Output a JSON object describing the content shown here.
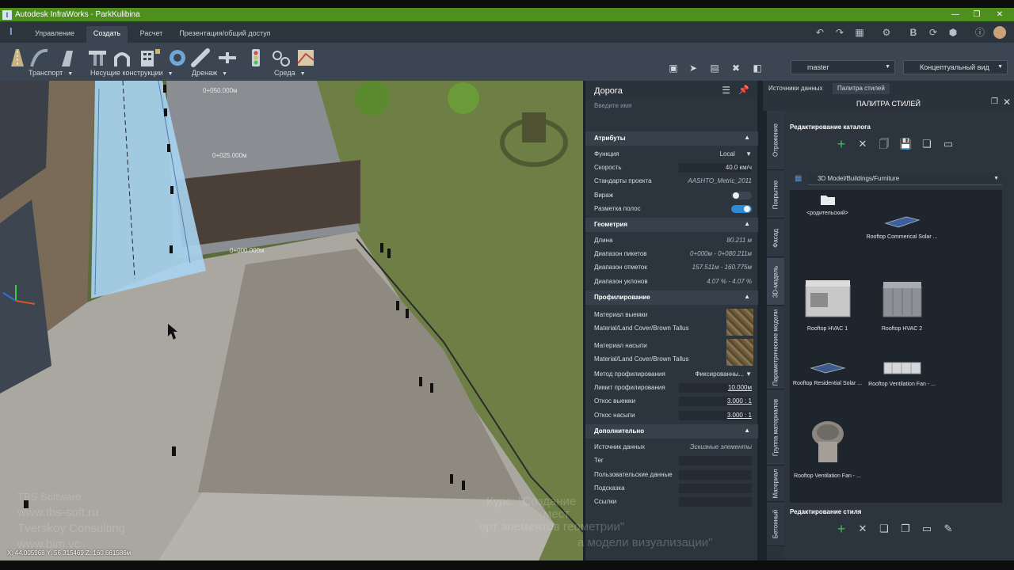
{
  "window": {
    "title": "Autodesk InfraWorks - ParkKulibina",
    "app_icon": "I"
  },
  "menu": {
    "tabs": [
      "Управление",
      "Создать",
      "Расчет",
      "Презентация/общий доступ"
    ],
    "active_tab": "Создать"
  },
  "ribbon": {
    "groups": [
      "Транспорт",
      "Несущие конструкции",
      "Дренаж",
      "Среда"
    ],
    "branch": "master",
    "view_mode": "Концептуальный вид"
  },
  "viewport": {
    "station_labels": [
      "0+050.000м",
      "0+025.000м",
      "0+000.000м"
    ],
    "coords": "X: 44.005968 Y: 56.315469 Z: 160.661586м"
  },
  "properties": {
    "title": "Дорога",
    "name_placeholder": "Введите имя",
    "attributes": {
      "header": "Атрибуты",
      "function_label": "Функция",
      "function_value": "Local",
      "speed_label": "Скорость",
      "speed_value": "40.0",
      "speed_unit": "км/ч",
      "standards_label": "Стандарты проекта",
      "standards_value": "AASHTO_Metric_2011",
      "superelevation_label": "Вираж",
      "lane_marking_label": "Разметка полос"
    },
    "geometry": {
      "header": "Геометрия",
      "length_label": "Длина",
      "length_value": "80.211  м",
      "station_range_label": "Диапазон пикетов",
      "station_range_value": "0+000м - 0+080.211м",
      "elev_range_label": "Диапазон отметок",
      "elev_range_value": "157.511м - 160.775м",
      "slope_range_label": "Диапазон уклонов",
      "slope_range_value": "4.07 % - 4.07 %"
    },
    "grading": {
      "header": "Профилирование",
      "cut_material_label": "Материал выемки",
      "cut_material_value": "Material/Land Cover/Brown Tallus",
      "fill_material_label": "Материал насыпи",
      "fill_material_value": "Material/Land Cover/Brown Tallus",
      "method_label": "Метод профилирования",
      "method_value": "Фиксированны...",
      "limit_label": "Лимит профилирования",
      "limit_value": "10.000м",
      "cut_slope_label": "Откос выемки",
      "cut_slope_value": "3.000 : 1",
      "fill_slope_label": "Откос насыпи",
      "fill_slope_value": "3.000 : 1"
    },
    "extra": {
      "header": "Дополнительно",
      "source_label": "Источник данных",
      "source_value": "Эскизные элементы",
      "tag_label": "Тег",
      "user_data_label": "Пользовательские данные",
      "hint_label": "Подсказка",
      "links_label": "Ссылки"
    }
  },
  "palette": {
    "tabs": [
      "Источники данных",
      "Палитра стилей"
    ],
    "active_tab": "Палитра стилей",
    "title": "ПАЛИТРА СТИЛЕЙ",
    "side_tabs": [
      "Отражение",
      "Покрытие",
      "Фасад",
      "3D-модель",
      "Параметрические модели",
      "Группа материалов",
      "Материал",
      "Бетонный"
    ],
    "active_side_tab": "3D-модель",
    "catalog_edit_label": "Редактирование каталога",
    "style_edit_label": "Редактирование стиля",
    "catalog_path": "3D Model/Buildings/Furniture",
    "items": [
      {
        "label": "<родительский>",
        "icon": "folder-icon"
      },
      {
        "label": "Rooftop Commerical Solar ...",
        "icon": "solar-panel-icon"
      },
      {
        "label": "Rooftop HVAC 1",
        "icon": "hvac-icon"
      },
      {
        "label": "Rooftop HVAC 2",
        "icon": "hvac-icon"
      },
      {
        "label": "Rooftop Residential Solar ...",
        "icon": "solar-panel-icon"
      },
      {
        "label": "Rooftop Ventilation Fan - ...",
        "icon": "fan-icon"
      },
      {
        "label": "Rooftop Ventilation Fan - ...",
        "icon": "turbine-vent-icon"
      }
    ]
  },
  "watermark": {
    "left_lines": [
      "TBS Software",
      "www.tbs-soft.ru",
      "Tverskoy Consulting",
      "www.bim.vc"
    ],
    "right_lines": [
      "Курс: \"Создание",
      "мест",
      "орт элементов геометрии\"",
      "а модели визуализации\""
    ]
  },
  "colors": {
    "accent": "#2f8ad6",
    "titlebar": "#4f8f1d",
    "add_green": "#3dbf4d"
  }
}
